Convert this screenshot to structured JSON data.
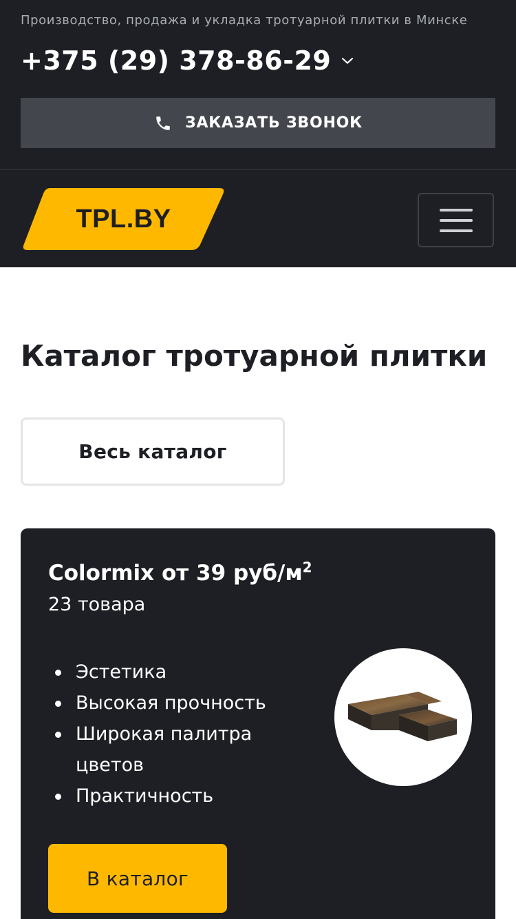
{
  "header": {
    "tagline": "Производство, продажа и укладка тротуарной плитки в Минске",
    "phone": "+375 (29) 378-86-29",
    "callback_label": "ЗАКАЗАТЬ ЗВОНОК",
    "icons": {
      "phone_dropdown": "chevron-down-icon",
      "callback": "phone-icon"
    }
  },
  "nav": {
    "logo_text": "TPL.BY",
    "menu_icon": "hamburger-menu-icon"
  },
  "main": {
    "title": "Каталог тротуарной плитки",
    "all_catalog_label": "Весь каталог"
  },
  "card": {
    "title_main": "Colormix от 39 руб/м",
    "title_sup": "2",
    "count": "23 товара",
    "features": [
      "Эстетика",
      "Высокая прочность",
      "Широкая палитра цветов",
      "Практичность"
    ],
    "button_label": "В каталог",
    "image": "paving-tile-product-image"
  },
  "colors": {
    "dark_bg": "#1d1f24",
    "callback_bg": "#43464c",
    "accent_yellow": "#ffb800",
    "white": "#ffffff",
    "muted_text": "#a9acb3"
  }
}
